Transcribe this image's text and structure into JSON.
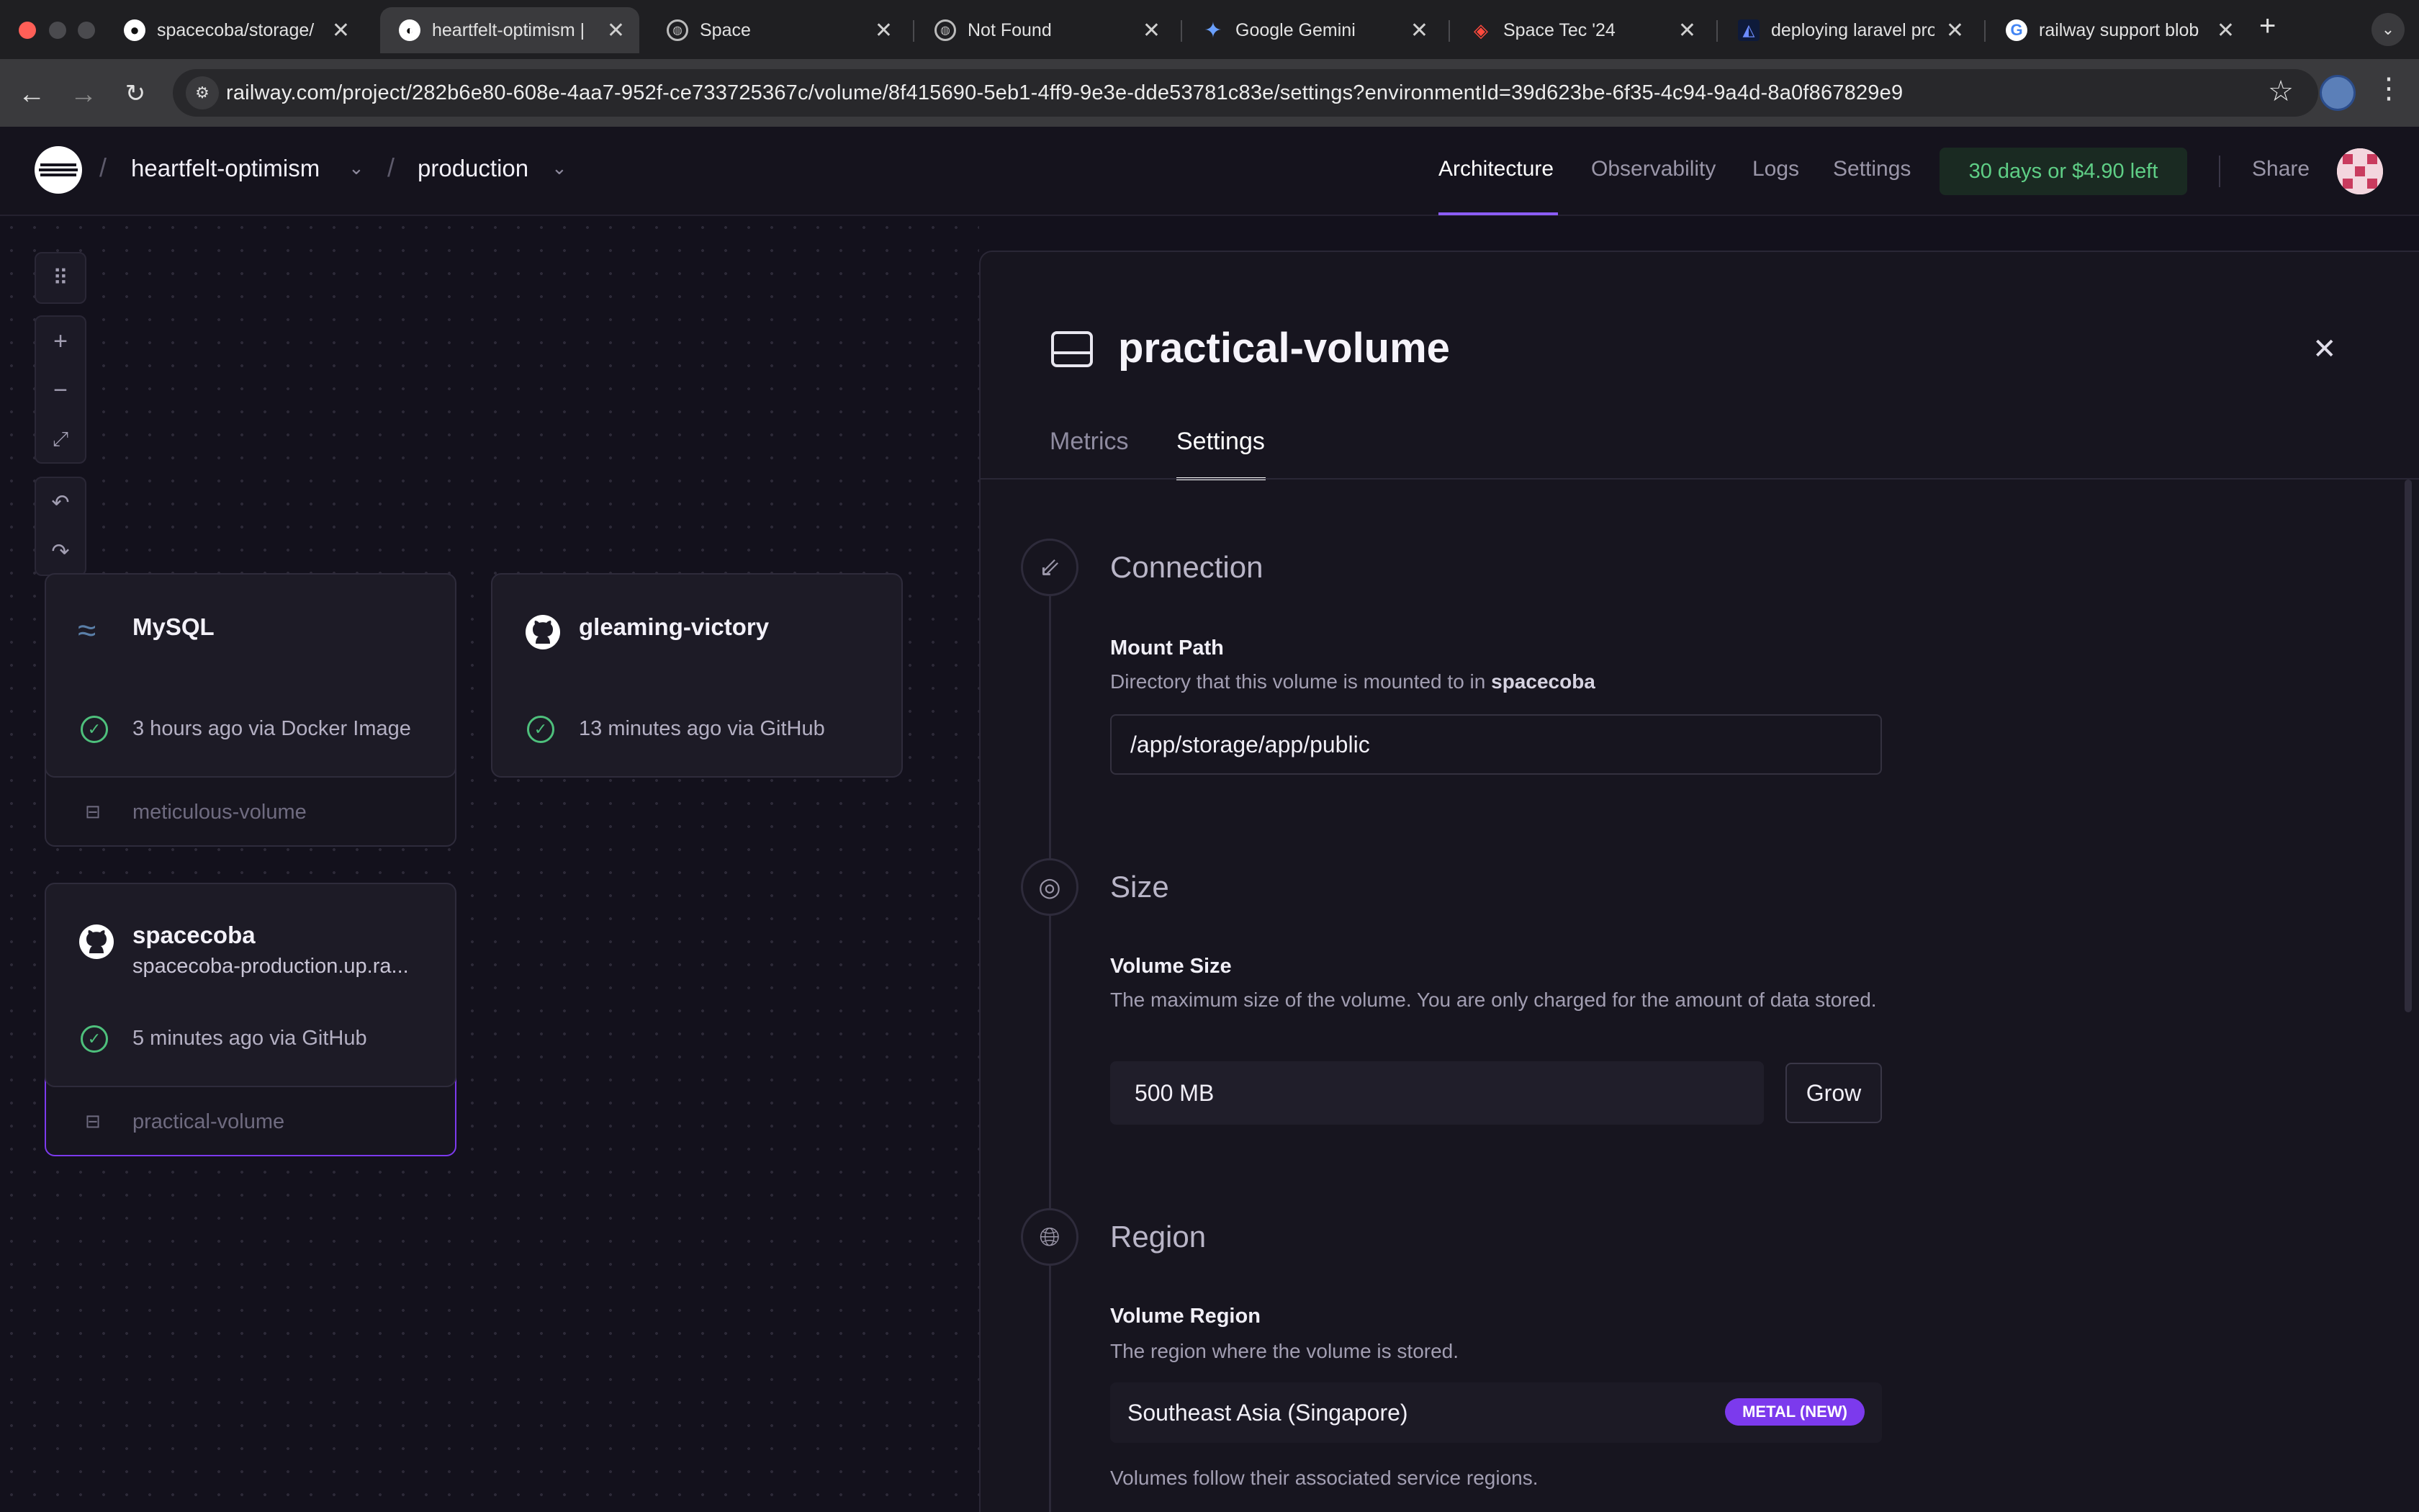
{
  "browser": {
    "tabs": [
      {
        "title": "spacecoba/storage/",
        "icon": "github-icon"
      },
      {
        "title": "heartfelt-optimism |",
        "icon": "railway-icon"
      },
      {
        "title": "Space",
        "icon": "globe-icon"
      },
      {
        "title": "Not Found",
        "icon": "globe-icon"
      },
      {
        "title": "Google Gemini",
        "icon": "gemini-icon"
      },
      {
        "title": "Space Tec '24",
        "icon": "laravel-icon"
      },
      {
        "title": "deploying laravel pro",
        "icon": "app-icon"
      },
      {
        "title": "railway support blob",
        "icon": "google-icon"
      }
    ],
    "close_glyph": "✕",
    "new_tab_glyph": "+",
    "url": "railway.com/project/282b6e80-608e-4aa7-952f-ce733725367c/volume/8f415690-5eb1-4ff9-9e3e-dde53781c83e/settings?environmentId=39d623be-6f35-4c94-9a4d-8a0f867829e9"
  },
  "header": {
    "project": "heartfelt-optimism",
    "environment": "production",
    "separator": "/",
    "nav": [
      "Architecture",
      "Observability",
      "Logs",
      "Settings"
    ],
    "trial": "30 days or $4.90 left",
    "share": "Share",
    "accent": "#8b5cf6"
  },
  "canvas": {
    "services": [
      {
        "name": "MySQL",
        "status": "3 hours ago via Docker Image",
        "volume": "meticulous-volume",
        "icon": "mysql-dolphin-icon"
      },
      {
        "name": "gleaming-victory",
        "status": "13 minutes ago via GitHub",
        "icon": "github-icon"
      },
      {
        "name": "spacecoba",
        "domain": "spacecoba-production.up.ra...",
        "status": "5 minutes ago via GitHub",
        "volume": "practical-volume",
        "icon": "github-icon"
      }
    ]
  },
  "panel": {
    "title": "practical-volume",
    "tabs": [
      "Metrics",
      "Settings"
    ],
    "active_tab": "Settings",
    "connection": {
      "heading": "Connection",
      "label": "Mount Path",
      "desc": "Directory that this volume is mounted to in",
      "desc_service": "spacecoba",
      "value": "/app/storage/app/public"
    },
    "size": {
      "heading": "Size",
      "label": "Volume Size",
      "desc": "The maximum size of the volume. You are only charged for the amount of data stored.",
      "value": "500 MB",
      "button": "Grow"
    },
    "region": {
      "heading": "Region",
      "label": "Volume Region",
      "desc": "The region where the volume is stored.",
      "value": "Southeast Asia (Singapore)",
      "badge": "METAL (NEW)",
      "note": "Volumes follow their associated service regions."
    }
  }
}
